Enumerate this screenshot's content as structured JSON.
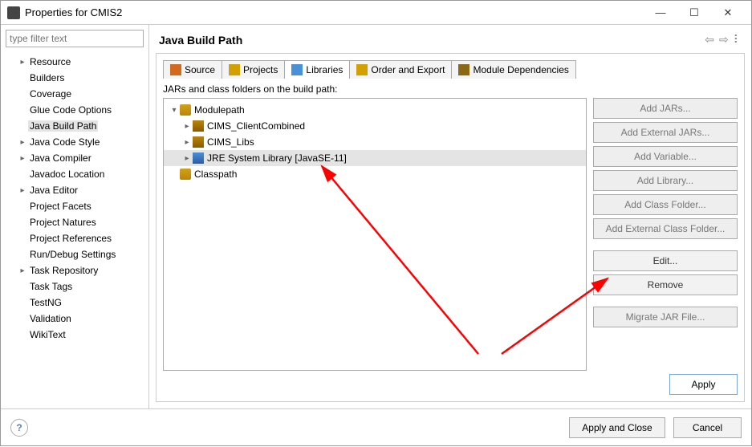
{
  "window": {
    "title": "Properties for CMIS2",
    "minimize": "—",
    "maximize": "☐",
    "close": "✕"
  },
  "filter": {
    "placeholder": "type filter text"
  },
  "sidebar": {
    "items": [
      {
        "label": "Resource",
        "expandable": true
      },
      {
        "label": "Builders"
      },
      {
        "label": "Coverage"
      },
      {
        "label": "Glue Code Options"
      },
      {
        "label": "Java Build Path",
        "selected": true
      },
      {
        "label": "Java Code Style",
        "expandable": true
      },
      {
        "label": "Java Compiler",
        "expandable": true
      },
      {
        "label": "Javadoc Location"
      },
      {
        "label": "Java Editor",
        "expandable": true
      },
      {
        "label": "Project Facets"
      },
      {
        "label": "Project Natures"
      },
      {
        "label": "Project References"
      },
      {
        "label": "Run/Debug Settings"
      },
      {
        "label": "Task Repository",
        "expandable": true
      },
      {
        "label": "Task Tags"
      },
      {
        "label": "TestNG"
      },
      {
        "label": "Validation"
      },
      {
        "label": "WikiText"
      }
    ]
  },
  "page": {
    "title": "Java Build Path"
  },
  "tabs": [
    {
      "label": "Source"
    },
    {
      "label": "Projects"
    },
    {
      "label": "Libraries",
      "active": true
    },
    {
      "label": "Order and Export"
    },
    {
      "label": "Module Dependencies"
    }
  ],
  "caption": "JARs and class folders on the build path:",
  "treepanel": {
    "root1": "Modulepath",
    "child1": "CIMS_ClientCombined",
    "child2": "CIMS_Libs",
    "child3": "JRE System Library [JavaSE-11]",
    "root2": "Classpath"
  },
  "buttons": {
    "addJars": "Add JARs...",
    "addExtJars": "Add External JARs...",
    "addVar": "Add Variable...",
    "addLib": "Add Library...",
    "addClassFolder": "Add Class Folder...",
    "addExtClassFolder": "Add External Class Folder...",
    "edit": "Edit...",
    "remove": "Remove",
    "migrate": "Migrate JAR File...",
    "apply": "Apply"
  },
  "footer": {
    "applyClose": "Apply and Close",
    "cancel": "Cancel"
  }
}
